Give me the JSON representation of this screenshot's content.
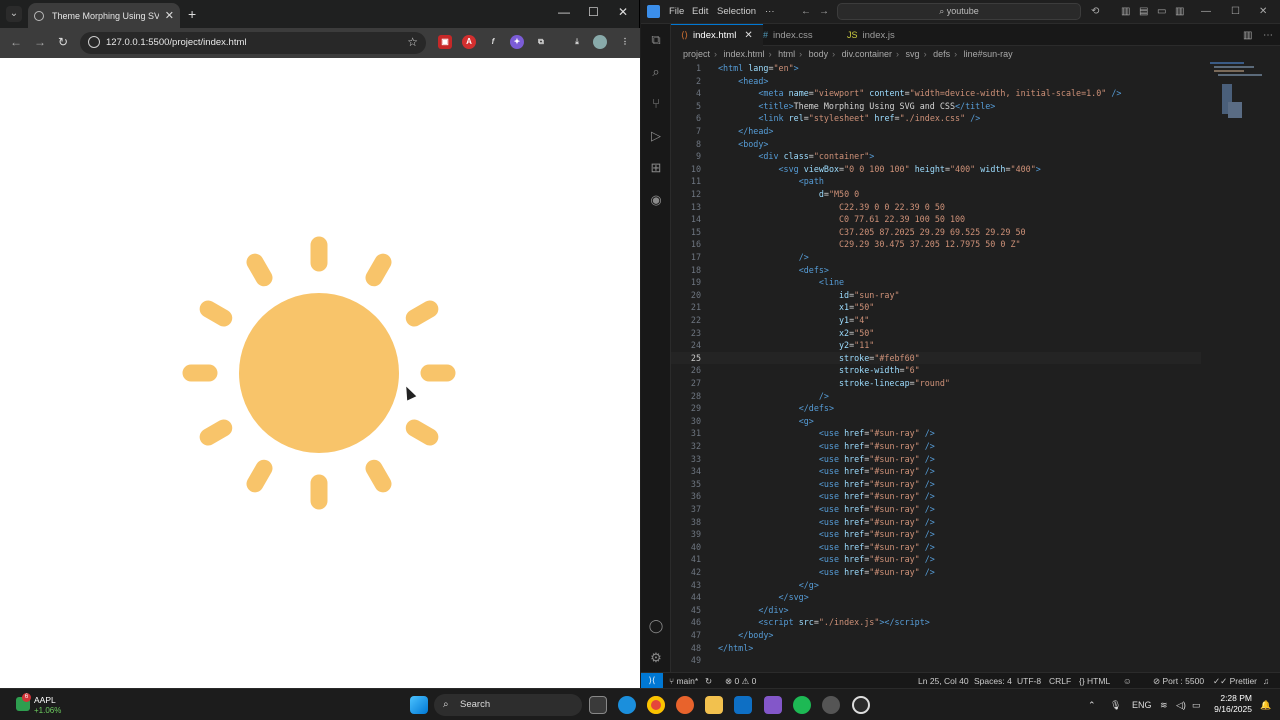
{
  "browser": {
    "tab_title": "Theme Morphing Using SVG an",
    "url": "127.0.0.1:5500/project/index.html",
    "sun": {
      "color": "#f8c46a",
      "ray_color": "#f8c46a",
      "ray_count": 12
    }
  },
  "vscode": {
    "menu": [
      "File",
      "Edit",
      "Selection",
      "···"
    ],
    "search": "youtube",
    "tabs": [
      {
        "label": "index.html",
        "icon": "html-file-icon",
        "active": true
      },
      {
        "label": "index.css",
        "icon": "css-file-icon",
        "active": false
      },
      {
        "label": "index.js",
        "icon": "js-file-icon",
        "active": false
      }
    ],
    "breadcrumbs": [
      "project",
      "index.html",
      "html",
      "body",
      "div.container",
      "svg",
      "defs",
      "line#sun-ray"
    ],
    "current_line": 25,
    "lines": [
      {
        "n": "1",
        "html": "<span class=\"t\">&lt;html</span> <span class=\"a\">lang</span>=<span class=\"s\">\"en\"</span><span class=\"t\">&gt;</span>"
      },
      {
        "n": "2",
        "html": "    <span class=\"t\">&lt;head&gt;</span>"
      },
      {
        "n": "4",
        "html": "        <span class=\"t\">&lt;meta</span> <span class=\"a\">name</span>=<span class=\"s\">\"viewport\"</span> <span class=\"a\">content</span>=<span class=\"s\">\"width=device-width, initial-scale=1.0\"</span> <span class=\"t\">/&gt;</span>"
      },
      {
        "n": "5",
        "html": "        <span class=\"t\">&lt;title&gt;</span>Theme Morphing Using SVG and CSS<span class=\"t\">&lt;/title&gt;</span>"
      },
      {
        "n": "6",
        "html": "        <span class=\"t\">&lt;link</span> <span class=\"a\">rel</span>=<span class=\"s\">\"stylesheet\"</span> <span class=\"a\">href</span>=<span class=\"s\">\"./index.css\"</span> <span class=\"t\">/&gt;</span>"
      },
      {
        "n": "7",
        "html": "    <span class=\"t\">&lt;/head&gt;</span>"
      },
      {
        "n": "8",
        "html": "    <span class=\"t\">&lt;body&gt;</span>"
      },
      {
        "n": "9",
        "html": "        <span class=\"t\">&lt;div</span> <span class=\"a\">class</span>=<span class=\"s\">\"container\"</span><span class=\"t\">&gt;</span>"
      },
      {
        "n": "10",
        "html": "            <span class=\"t\">&lt;svg</span> <span class=\"a\">viewBox</span>=<span class=\"s\">\"0 0 100 100\"</span> <span class=\"a\">height</span>=<span class=\"s\">\"400\"</span> <span class=\"a\">width</span>=<span class=\"s\">\"400\"</span><span class=\"t\">&gt;</span>"
      },
      {
        "n": "11",
        "html": "                <span class=\"t\">&lt;path</span>"
      },
      {
        "n": "12",
        "html": "                    <span class=\"a\">d</span>=<span class=\"s\">\"M50 0</span>"
      },
      {
        "n": "13",
        "html": "<span class=\"s\">                        C22.39 0 0 22.39 0 50</span>"
      },
      {
        "n": "14",
        "html": "<span class=\"s\">                        C0 77.61 22.39 100 50 100</span>"
      },
      {
        "n": "15",
        "html": "<span class=\"s\">                        C37.205 87.2025 29.29 69.525 29.29 50</span>"
      },
      {
        "n": "16",
        "html": "<span class=\"s\">                        C29.29 30.475 37.205 12.7975 50 0 Z\"</span>"
      },
      {
        "n": "17",
        "html": "                <span class=\"t\">/&gt;</span>"
      },
      {
        "n": "18",
        "html": "                <span class=\"t\">&lt;defs&gt;</span>"
      },
      {
        "n": "19",
        "html": "                    <span class=\"t\">&lt;line</span>"
      },
      {
        "n": "20",
        "html": "                        <span class=\"a\">id</span>=<span class=\"s\">\"sun-ray\"</span>"
      },
      {
        "n": "21",
        "html": "                        <span class=\"a\">x1</span>=<span class=\"s\">\"50\"</span>"
      },
      {
        "n": "22",
        "html": "                        <span class=\"a\">y1</span>=<span class=\"s\">\"4\"</span>"
      },
      {
        "n": "23",
        "html": "                        <span class=\"a\">x2</span>=<span class=\"s\">\"50\"</span>"
      },
      {
        "n": "24",
        "html": "                        <span class=\"a\">y2</span>=<span class=\"s\">\"11\"</span>"
      },
      {
        "n": "25",
        "html": "                        <span class=\"a\">stroke</span>=<span class=\"s\">\"#febf60\"</span>"
      },
      {
        "n": "26",
        "html": "                        <span class=\"a\">stroke-width</span>=<span class=\"s\">\"6\"</span>"
      },
      {
        "n": "27",
        "html": "                        <span class=\"a\">stroke-linecap</span>=<span class=\"s\">\"round\"</span>"
      },
      {
        "n": "28",
        "html": "                    <span class=\"t\">/&gt;</span>"
      },
      {
        "n": "29",
        "html": "                <span class=\"t\">&lt;/defs&gt;</span>"
      },
      {
        "n": "30",
        "html": "                <span class=\"t\">&lt;g&gt;</span>"
      },
      {
        "n": "31",
        "html": "                    <span class=\"t\">&lt;use</span> <span class=\"a\">href</span>=<span class=\"s\">\"#sun-ray\"</span> <span class=\"t\">/&gt;</span>"
      },
      {
        "n": "32",
        "html": "                    <span class=\"t\">&lt;use</span> <span class=\"a\">href</span>=<span class=\"s\">\"#sun-ray\"</span> <span class=\"t\">/&gt;</span>"
      },
      {
        "n": "33",
        "html": "                    <span class=\"t\">&lt;use</span> <span class=\"a\">href</span>=<span class=\"s\">\"#sun-ray\"</span> <span class=\"t\">/&gt;</span>"
      },
      {
        "n": "34",
        "html": "                    <span class=\"t\">&lt;use</span> <span class=\"a\">href</span>=<span class=\"s\">\"#sun-ray\"</span> <span class=\"t\">/&gt;</span>"
      },
      {
        "n": "35",
        "html": "                    <span class=\"t\">&lt;use</span> <span class=\"a\">href</span>=<span class=\"s\">\"#sun-ray\"</span> <span class=\"t\">/&gt;</span>"
      },
      {
        "n": "36",
        "html": "                    <span class=\"t\">&lt;use</span> <span class=\"a\">href</span>=<span class=\"s\">\"#sun-ray\"</span> <span class=\"t\">/&gt;</span>"
      },
      {
        "n": "37",
        "html": "                    <span class=\"t\">&lt;use</span> <span class=\"a\">href</span>=<span class=\"s\">\"#sun-ray\"</span> <span class=\"t\">/&gt;</span>"
      },
      {
        "n": "38",
        "html": "                    <span class=\"t\">&lt;use</span> <span class=\"a\">href</span>=<span class=\"s\">\"#sun-ray\"</span> <span class=\"t\">/&gt;</span>"
      },
      {
        "n": "39",
        "html": "                    <span class=\"t\">&lt;use</span> <span class=\"a\">href</span>=<span class=\"s\">\"#sun-ray\"</span> <span class=\"t\">/&gt;</span>"
      },
      {
        "n": "40",
        "html": "                    <span class=\"t\">&lt;use</span> <span class=\"a\">href</span>=<span class=\"s\">\"#sun-ray\"</span> <span class=\"t\">/&gt;</span>"
      },
      {
        "n": "41",
        "html": "                    <span class=\"t\">&lt;use</span> <span class=\"a\">href</span>=<span class=\"s\">\"#sun-ray\"</span> <span class=\"t\">/&gt;</span>"
      },
      {
        "n": "42",
        "html": "                    <span class=\"t\">&lt;use</span> <span class=\"a\">href</span>=<span class=\"s\">\"#sun-ray\"</span> <span class=\"t\">/&gt;</span>"
      },
      {
        "n": "43",
        "html": "                <span class=\"t\">&lt;/g&gt;</span>"
      },
      {
        "n": "44",
        "html": "            <span class=\"t\">&lt;/svg&gt;</span>"
      },
      {
        "n": "45",
        "html": "        <span class=\"t\">&lt;/div&gt;</span>"
      },
      {
        "n": "46",
        "html": "        <span class=\"t\">&lt;script</span> <span class=\"a\">src</span>=<span class=\"s\">\"./index.js\"</span><span class=\"t\">&gt;&lt;/script&gt;</span>"
      },
      {
        "n": "47",
        "html": "    <span class=\"t\">&lt;/body&gt;</span>"
      },
      {
        "n": "48",
        "html": "<span class=\"t\">&lt;/html&gt;</span>"
      },
      {
        "n": "49",
        "html": ""
      }
    ],
    "status": {
      "branch": "main*",
      "problems": "0",
      "warnings": "0",
      "position": "Ln 25, Col 40",
      "spaces": "Spaces: 4",
      "encoding": "UTF-8",
      "eol": "CRLF",
      "language": "HTML",
      "port": "Port : 5500",
      "formatter": "Prettier"
    }
  },
  "taskbar": {
    "stock_name": "AAPL",
    "stock_change": "+1.06%",
    "stock_badge": "6",
    "search": "Search",
    "lang": "ENG",
    "time": "2:28 PM",
    "date": "9/16/2025"
  }
}
